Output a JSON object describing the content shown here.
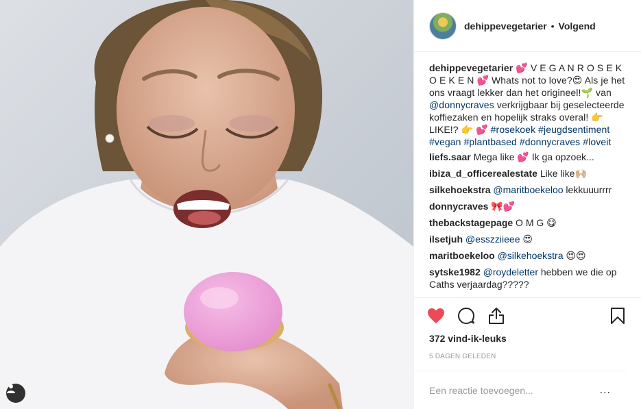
{
  "post": {
    "header": {
      "username": "dehippevegetarier",
      "separator": "•",
      "follow_label": "Volgend"
    },
    "caption": {
      "username": "dehippevegetarier",
      "parts": [
        {
          "t": " 💕 V E G A N R O S E K O E K E N 💕 Whats not to love?😍 Als je het ons vraagt lekker dan het origineel!🌱 van ",
          "link": false
        },
        {
          "t": "@donnycraves",
          "link": true
        },
        {
          "t": " verkrijgbaar bij geselecteerde koffiezaken en hopelijk straks overal! 👉 LIKE!? 👉 💕 ",
          "link": false
        },
        {
          "t": "#rosekoek",
          "link": true
        },
        {
          "t": " ",
          "link": false
        },
        {
          "t": "#jeugdsentiment",
          "link": true
        },
        {
          "t": " ",
          "link": false
        },
        {
          "t": "#vegan",
          "link": true
        },
        {
          "t": " ",
          "link": false
        },
        {
          "t": "#plantbased",
          "link": true
        },
        {
          "t": " ",
          "link": false
        },
        {
          "t": "#donnycraves",
          "link": true
        },
        {
          "t": " ",
          "link": false
        },
        {
          "t": "#loveit",
          "link": true
        }
      ]
    },
    "comments": [
      {
        "user": "liefs.saar",
        "parts": [
          {
            "t": " Mega like 💕 Ik ga opzoek...",
            "link": false
          }
        ]
      },
      {
        "user": "ibiza_d_officerealestate",
        "parts": [
          {
            "t": " Like like🙌🏼",
            "link": false
          }
        ]
      },
      {
        "user": "silkehoekstra",
        "parts": [
          {
            "t": " ",
            "link": false
          },
          {
            "t": "@maritboekeloo",
            "link": true
          },
          {
            "t": " lekkuuurrrr",
            "link": false
          }
        ]
      },
      {
        "user": "donnycraves",
        "parts": [
          {
            "t": " 🎀💕",
            "link": false
          }
        ]
      },
      {
        "user": "thebackstagepage",
        "parts": [
          {
            "t": " O M G 😋",
            "link": false
          }
        ]
      },
      {
        "user": "ilsetjuh",
        "parts": [
          {
            "t": " ",
            "link": false
          },
          {
            "t": "@esszziieee",
            "link": true
          },
          {
            "t": " 😍",
            "link": false
          }
        ]
      },
      {
        "user": "maritboekeloo",
        "parts": [
          {
            "t": " ",
            "link": false
          },
          {
            "t": "@silkehoekstra",
            "link": true
          },
          {
            "t": " 😍😍",
            "link": false
          }
        ]
      },
      {
        "user": "sytske1982",
        "parts": [
          {
            "t": " ",
            "link": false
          },
          {
            "t": "@roydeletter",
            "link": true
          },
          {
            "t": " hebben we die op Caths verjaardag?????",
            "link": false
          }
        ]
      }
    ],
    "actions": {
      "like_icon": "heart-filled-icon",
      "comment_icon": "speech-bubble-icon",
      "share_icon": "share-icon",
      "save_icon": "bookmark-icon"
    },
    "likes_text": "372 vind-ik-leuks",
    "time_text": "5 dagen geleden",
    "add_comment": {
      "placeholder": "Een reactie toevoegen...",
      "more_label": "..."
    },
    "colors": {
      "heart": "#ed4956",
      "link": "#003569",
      "muted": "#999999",
      "text": "#262626",
      "border": "#efefef"
    }
  }
}
